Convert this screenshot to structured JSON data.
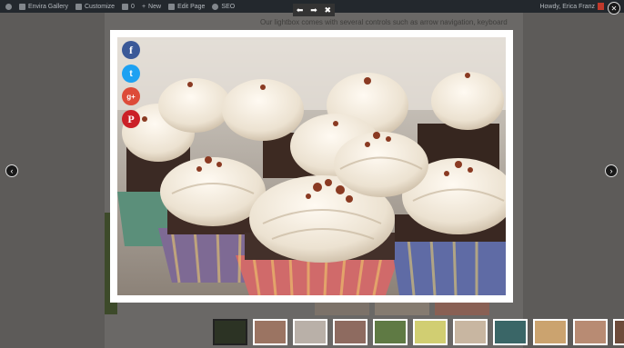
{
  "adminbar": {
    "site_name": "Envira Gallery",
    "customize": "Customize",
    "comments_count": "0",
    "new": "New",
    "edit_page": "Edit Page",
    "seo": "SEO",
    "howdy": "Howdy, Erica Franz"
  },
  "page": {
    "text": "Our lightbox comes with several controls such as arrow navigation, keyboard"
  },
  "lightbox": {
    "prev_glyph": "‹",
    "next_glyph": "›",
    "close_glyph": "✕",
    "top_prev": "⬅",
    "top_next": "➡",
    "top_close": "✖",
    "image_alt": "Chocolate cupcakes with cream frosting and bacon bits"
  },
  "social": {
    "facebook": "f",
    "twitter": "t",
    "googleplus": "g+",
    "pinterest": "P"
  },
  "thumbnails": [
    {
      "name": "dark-plate",
      "color": "#2c3324"
    },
    {
      "name": "cupcakes",
      "color": "#9b7462"
    },
    {
      "name": "cupcakes-tray",
      "color": "#b9b0a8"
    },
    {
      "name": "berries",
      "color": "#8e6b60"
    },
    {
      "name": "greens",
      "color": "#5f7a44"
    },
    {
      "name": "drinks",
      "color": "#d1ce72"
    },
    {
      "name": "bowls",
      "color": "#c8b6a1"
    },
    {
      "name": "teal-dish",
      "color": "#3a6667"
    },
    {
      "name": "pastries",
      "color": "#cba36f"
    },
    {
      "name": "soup",
      "color": "#b88b73"
    },
    {
      "name": "salad",
      "color": "#6d4b3a"
    }
  ]
}
